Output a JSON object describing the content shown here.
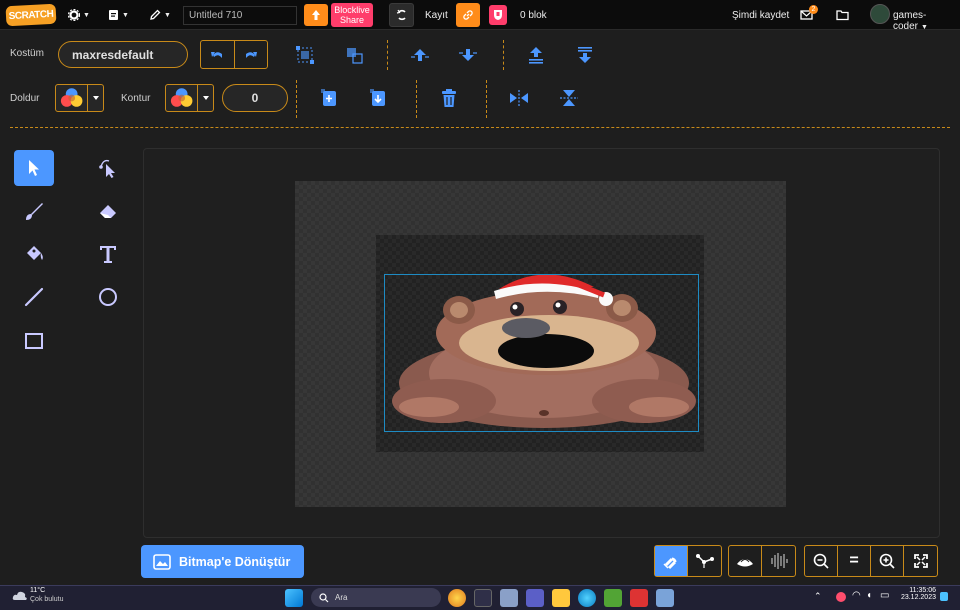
{
  "menubar": {
    "logo_text": "SCRATCH",
    "title_value": "Untitled 710",
    "blocklive_label": "Blocklive Share",
    "save_label": "Kayıt",
    "block_count": "0 blok",
    "save_now_label": "Şimdi kaydet",
    "notification_count": "2",
    "username": "games-coder"
  },
  "toolbar": {
    "costume_label": "Kostüm",
    "costume_name": "maxresdefault",
    "fill_label": "Doldur",
    "outline_label": "Kontur",
    "outline_width": "0"
  },
  "bottom": {
    "convert_label": "Bitmap'e Dönüştür",
    "zoom_reset_label": "="
  },
  "taskbar": {
    "weather_temp": "11°C",
    "weather_desc": "Çok bulutu",
    "search_placeholder": "Ara",
    "time": "11:35:06",
    "date": "23.12.2023"
  },
  "colors": {
    "accent_orange": "#ff8c1a",
    "dashed_border": "#c88a19",
    "active_blue": "#4c97ff",
    "pink": "#ff3d6b"
  }
}
